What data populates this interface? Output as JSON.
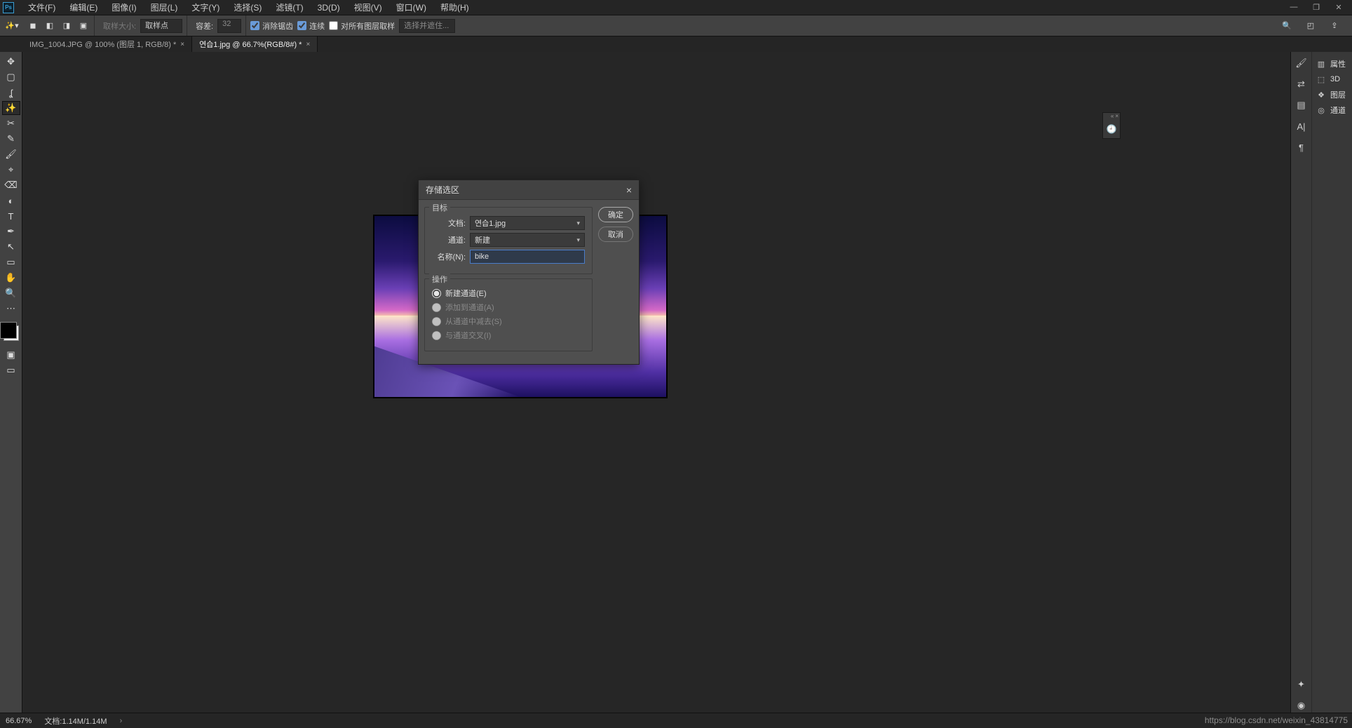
{
  "menu": {
    "items": [
      "文件(F)",
      "编辑(E)",
      "图像(I)",
      "图层(L)",
      "文字(Y)",
      "选择(S)",
      "滤镜(T)",
      "3D(D)",
      "视图(V)",
      "窗口(W)",
      "帮助(H)"
    ]
  },
  "window_controls": {
    "min": "—",
    "restore": "❐",
    "close": "✕"
  },
  "optionsbar": {
    "sample_size_label": "取样大小:",
    "sample_size_value": "取样点",
    "tolerance_label": "容差:",
    "tolerance_value": "32",
    "antialias": "消除锯齿",
    "contiguous": "连续",
    "allLayers": "对所有图层取样",
    "select_subject": "选择并遮住..."
  },
  "tabs": [
    {
      "title": "IMG_1004.JPG @ 100% (图层 1, RGB/8) *",
      "active": false
    },
    {
      "title": "연습1.jpg @ 66.7%(RGB/8#) *",
      "active": true
    }
  ],
  "dialog": {
    "title": "存储选区",
    "ok": "确定",
    "cancel": "取消",
    "target_legend": "目标",
    "doc_label": "文档:",
    "doc_value": "연습1.jpg",
    "channel_label": "通道:",
    "channel_value": "新建",
    "name_label": "名称(N):",
    "name_value": "bike",
    "op_legend": "操作",
    "ops": [
      {
        "label": "新建通道(E)",
        "enabled": true,
        "checked": true
      },
      {
        "label": "添加到通道(A)",
        "enabled": false,
        "checked": false
      },
      {
        "label": "从通道中减去(S)",
        "enabled": false,
        "checked": false
      },
      {
        "label": "与通道交叉(I)",
        "enabled": false,
        "checked": false
      }
    ]
  },
  "right_panels": [
    "属性",
    "3D",
    "图层",
    "通道"
  ],
  "status": {
    "zoom": "66.67%",
    "doc": "文档:1.14M/1.14M"
  },
  "watermark": "https://blog.csdn.net/weixin_43814775"
}
